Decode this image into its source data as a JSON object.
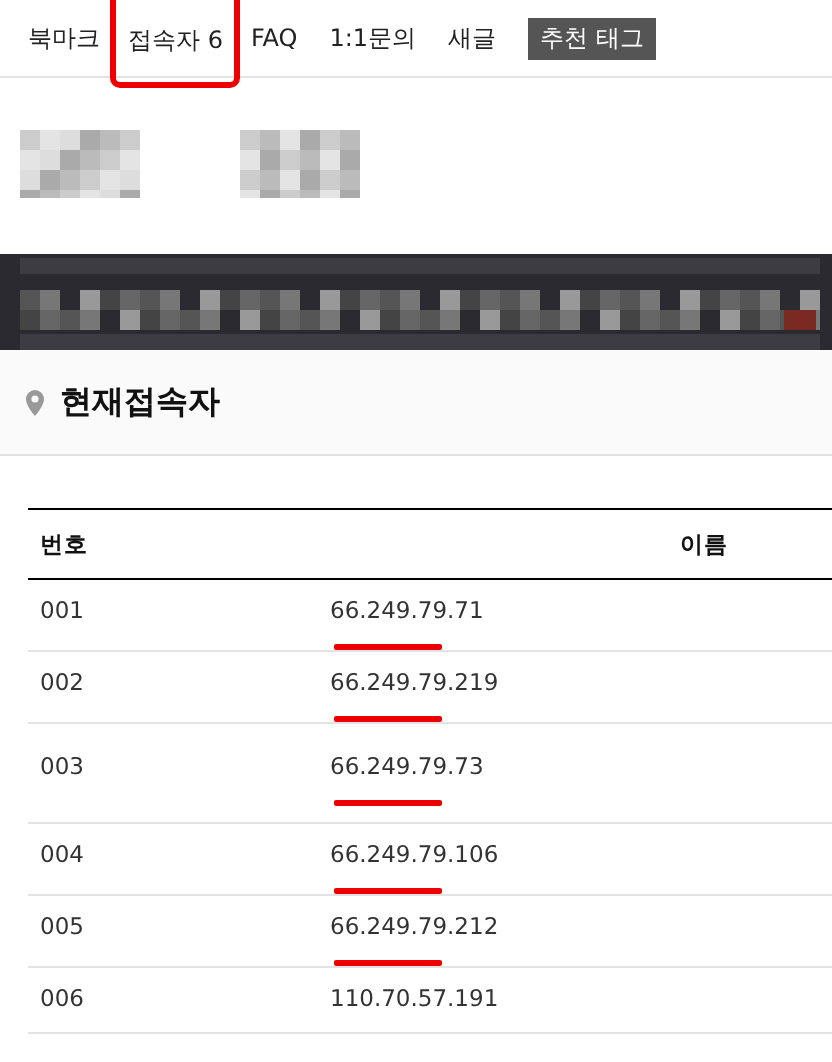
{
  "tabs": [
    {
      "label": "북마크",
      "highlighted": false,
      "kind": "link"
    },
    {
      "label": "접속자 6",
      "highlighted": true,
      "kind": "link"
    },
    {
      "label": "FAQ",
      "highlighted": false,
      "kind": "link"
    },
    {
      "label": "1:1문의",
      "highlighted": false,
      "kind": "link"
    },
    {
      "label": "새글",
      "highlighted": false,
      "kind": "link"
    },
    {
      "label": "추천 태그",
      "highlighted": false,
      "kind": "tag"
    }
  ],
  "section": {
    "title": "현재접속자"
  },
  "table": {
    "columns": [
      "번호",
      "이름"
    ],
    "rows": [
      {
        "number": "001",
        "ip": "66.249.79.71",
        "highlighted": true
      },
      {
        "number": "002",
        "ip": "66.249.79.219",
        "highlighted": true
      },
      {
        "number": "003",
        "ip": "66.249.79.73",
        "highlighted": true
      },
      {
        "number": "004",
        "ip": "66.249.79.106",
        "highlighted": true
      },
      {
        "number": "005",
        "ip": "66.249.79.212",
        "highlighted": true
      },
      {
        "number": "006",
        "ip": "110.70.57.191",
        "highlighted": false
      }
    ]
  }
}
